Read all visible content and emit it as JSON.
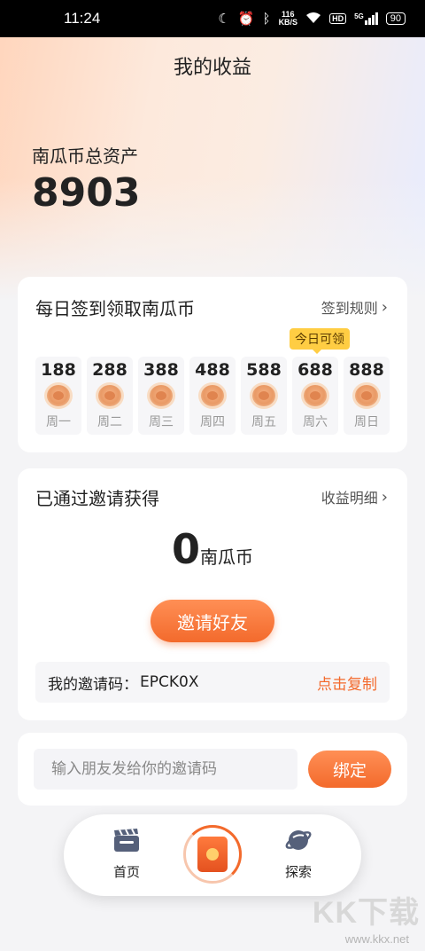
{
  "status_bar": {
    "time": "11:24",
    "net_speed": "116",
    "net_unit": "KB/S",
    "hd": "HD",
    "network": "5G",
    "battery": "90"
  },
  "header": {
    "title": "我的收益"
  },
  "assets": {
    "label": "南瓜币总资产",
    "value": "8903"
  },
  "checkin": {
    "title": "每日签到领取南瓜币",
    "rules_link": "签到规则",
    "today_badge": "今日可领",
    "days": [
      {
        "amount": "188",
        "weekday": "周一"
      },
      {
        "amount": "288",
        "weekday": "周二"
      },
      {
        "amount": "388",
        "weekday": "周三"
      },
      {
        "amount": "488",
        "weekday": "周四"
      },
      {
        "amount": "588",
        "weekday": "周五"
      },
      {
        "amount": "688",
        "weekday": "周六"
      },
      {
        "amount": "888",
        "weekday": "周日"
      }
    ]
  },
  "invite": {
    "title": "已通过邀请获得",
    "details_link": "收益明细",
    "amount": "0",
    "unit": "南瓜币",
    "invite_button": "邀请好友",
    "code_label": "我的邀请码：",
    "code": "EPCK0X",
    "copy_link": "点击复制"
  },
  "bind": {
    "placeholder": "输入朋友发给你的邀请码",
    "button": "绑定"
  },
  "bottom_nav": {
    "items": [
      {
        "label": "首页",
        "icon": "clapperboard-icon"
      },
      {
        "label": "",
        "icon": "red-envelope-icon"
      },
      {
        "label": "探索",
        "icon": "planet-icon"
      }
    ]
  },
  "watermark": {
    "text": "KK下载",
    "url": "www.kkx.net"
  }
}
